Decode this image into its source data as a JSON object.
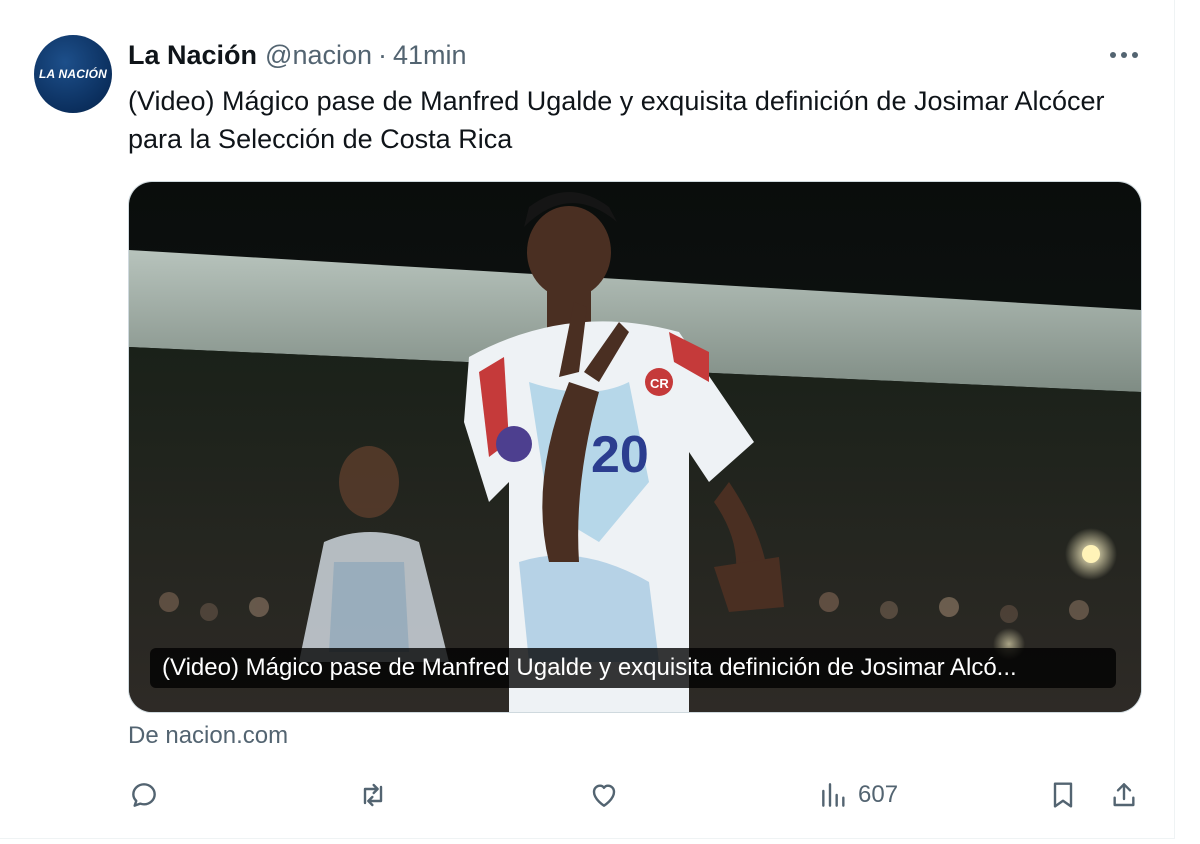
{
  "tweet": {
    "author_name": "La Nación",
    "handle": "@nacion",
    "separator": "·",
    "time": "41min",
    "avatar_text": "LA NACIÓN",
    "text": "(Video) Mágico pase de Manfred Ugalde y exquisita definición de Josimar Alcócer para la Selección de Costa Rica",
    "media": {
      "caption": "(Video) Mágico pase de Manfred Ugalde y exquisita definición de Josimar Alcó...",
      "jersey_number": "20",
      "crest_text": "CR"
    },
    "source": "De nacion.com"
  },
  "actions": {
    "reply_icon": "reply-icon",
    "retweet_icon": "retweet-icon",
    "like_icon": "heart-icon",
    "views_icon": "views-icon",
    "views_count": "607",
    "bookmark_icon": "bookmark-icon",
    "share_icon": "share-icon",
    "more_icon": "more-icon"
  },
  "colors": {
    "text_primary": "#0f1419",
    "text_secondary": "#536471",
    "avatar_bg": "#0b2f5e",
    "border": "#cfd9de"
  }
}
